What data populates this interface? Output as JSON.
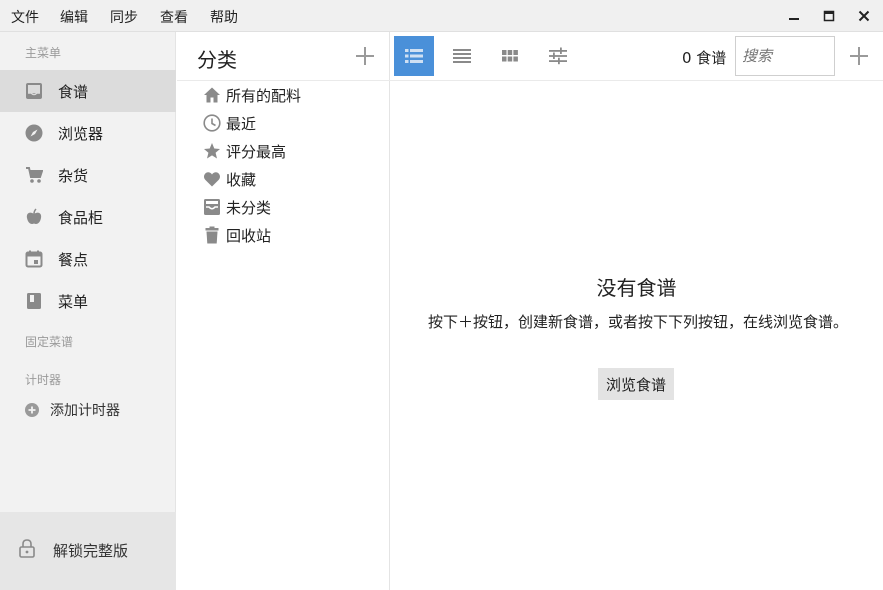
{
  "menubar": {
    "items": [
      "文件",
      "编辑",
      "同步",
      "查看",
      "帮助"
    ]
  },
  "sidebar": {
    "main_menu_title": "主菜单",
    "items": [
      {
        "label": "食谱",
        "icon": "inbox-icon",
        "active": true
      },
      {
        "label": "浏览器",
        "icon": "compass-icon"
      },
      {
        "label": "杂货",
        "icon": "cart-icon"
      },
      {
        "label": "食品柜",
        "icon": "apple-icon"
      },
      {
        "label": "餐点",
        "icon": "calendar-icon"
      },
      {
        "label": "菜单",
        "icon": "book-icon"
      }
    ],
    "pinned_title": "固定菜谱",
    "timers_title": "计时器",
    "add_timer": "添加计时器",
    "unlock": "解锁完整版"
  },
  "categories": {
    "title": "分类",
    "items": [
      {
        "label": "所有的配料",
        "icon": "home-icon"
      },
      {
        "label": "最近",
        "icon": "clock-icon"
      },
      {
        "label": "评分最高",
        "icon": "star-icon"
      },
      {
        "label": "收藏",
        "icon": "heart-icon"
      },
      {
        "label": "未分类",
        "icon": "tray-icon"
      },
      {
        "label": "回收站",
        "icon": "trash-icon"
      }
    ]
  },
  "main": {
    "recipe_count": "0 食谱",
    "search_placeholder": "搜索",
    "empty_title": "没有食谱",
    "empty_desc": "按下＋按钮，创建新食谱，或者按下下列按钮，在线浏览食谱。",
    "browse_button": "浏览食谱"
  },
  "colors": {
    "accent": "#4a90d9",
    "sidebar_bg": "#f2f2f2",
    "active_item_bg": "#dcdcdc",
    "icon_gray": "#8a8a8a"
  }
}
